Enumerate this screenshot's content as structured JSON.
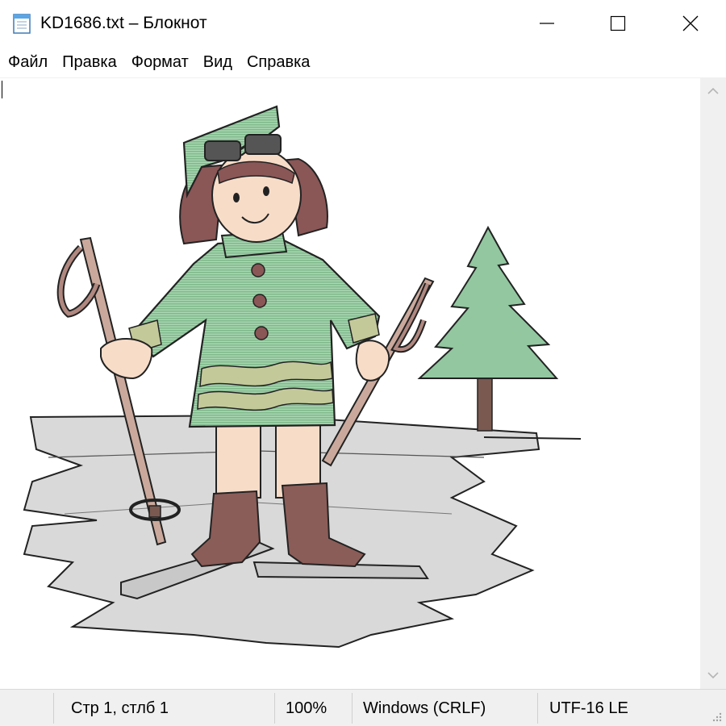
{
  "window": {
    "title": "KD1686.txt – Блокнот",
    "icon": "notepad-icon",
    "controls": [
      "minimize-icon",
      "maximize-icon",
      "close-icon"
    ]
  },
  "menu": {
    "items": [
      {
        "label": "Файл"
      },
      {
        "label": "Правка"
      },
      {
        "label": "Формат"
      },
      {
        "label": "Вид"
      },
      {
        "label": "Справка"
      }
    ]
  },
  "editor": {
    "content_description": "ASCII-style art of a girl skiing next to a fir tree",
    "colors": {
      "coat": "#8fc59b",
      "hair": "#8a5656",
      "boots": "#8a5a55",
      "skin": "#f6d6c0",
      "tree": "#8fc59b",
      "trunk": "#7a5a50",
      "snow": "#d6d6d6",
      "outline": "#1a1a1a"
    }
  },
  "status": {
    "position": "Стр 1, стлб 1",
    "zoom": "100%",
    "line_ending": "Windows (CRLF)",
    "encoding": "UTF-16 LE"
  }
}
